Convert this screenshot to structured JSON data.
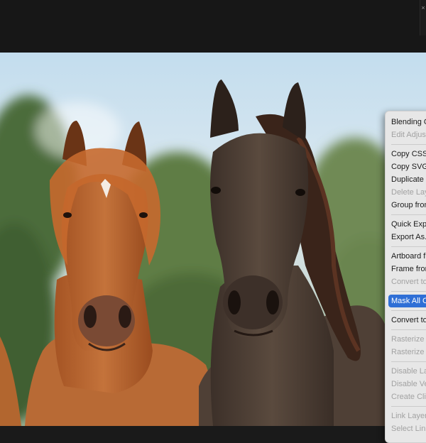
{
  "window": {
    "close_glyph": "×"
  },
  "canvas": {
    "image": "two-horses-photo"
  },
  "context_menu": {
    "groups": [
      [
        {
          "label": "Blending O",
          "enabled": true
        },
        {
          "label": "Edit Adjust",
          "enabled": false
        }
      ],
      [
        {
          "label": "Copy CSS",
          "enabled": true
        },
        {
          "label": "Copy SVG",
          "enabled": true
        },
        {
          "label": "Duplicate L",
          "enabled": true
        },
        {
          "label": "Delete Lay",
          "enabled": false
        },
        {
          "label": "Group from",
          "enabled": true
        }
      ],
      [
        {
          "label": "Quick Expo",
          "enabled": true
        },
        {
          "label": "Export As...",
          "enabled": true
        }
      ],
      [
        {
          "label": "Artboard fr",
          "enabled": true
        },
        {
          "label": "Frame from",
          "enabled": true
        },
        {
          "label": "Convert to",
          "enabled": false
        }
      ],
      [
        {
          "label": "Mask All C",
          "enabled": true,
          "selected": true
        }
      ],
      [
        {
          "label": "Convert to",
          "enabled": true
        }
      ],
      [
        {
          "label": "Rasterize L",
          "enabled": false
        },
        {
          "label": "Rasterize L",
          "enabled": false
        }
      ],
      [
        {
          "label": "Disable La",
          "enabled": false
        },
        {
          "label": "Disable Ve",
          "enabled": false
        },
        {
          "label": "Create Clip",
          "enabled": false
        }
      ],
      [
        {
          "label": "Link Layer",
          "enabled": false
        },
        {
          "label": "Select Link",
          "enabled": false
        }
      ]
    ]
  },
  "colors": {
    "toolbar": "#171717",
    "menu_bg": "#e7e7e7",
    "menu_selected": "#2f6fd6",
    "sky": "#cfe2ee",
    "chestnut": "#b3612d",
    "dark_horse": "#4d3f34"
  }
}
